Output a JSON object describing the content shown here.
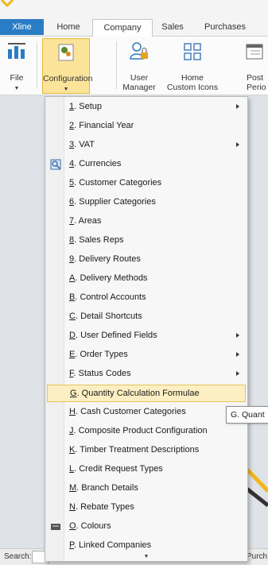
{
  "tabs": [
    {
      "label": "Xline"
    },
    {
      "label": "Home"
    },
    {
      "label": "Company"
    },
    {
      "label": "Sales"
    },
    {
      "label": "Purchases"
    }
  ],
  "ribbon": {
    "file": {
      "label": "File"
    },
    "configuration": {
      "label": "Configuration"
    },
    "user_manager": {
      "label_line1": "User",
      "label_line2": "Manager"
    },
    "home_custom_icons": {
      "label_line1": "Home",
      "label_line2": "Custom Icons"
    },
    "post_period": {
      "label_line1": "Post",
      "label_line2": "Perio"
    }
  },
  "menu": {
    "items": [
      {
        "key": "1",
        "rest": ". Setup",
        "submenu": true,
        "icon": ""
      },
      {
        "key": "2",
        "rest": ". Financial Year",
        "submenu": false,
        "icon": ""
      },
      {
        "key": "3",
        "rest": ". VAT",
        "submenu": true,
        "icon": ""
      },
      {
        "key": "4",
        "rest": ". Currencies",
        "submenu": false,
        "icon": "currency-search-icon"
      },
      {
        "key": "5",
        "rest": ". Customer Categories",
        "submenu": false,
        "icon": ""
      },
      {
        "key": "6",
        "rest": ". Supplier Categories",
        "submenu": false,
        "icon": ""
      },
      {
        "key": "7",
        "rest": ". Areas",
        "submenu": false,
        "icon": ""
      },
      {
        "key": "8",
        "rest": ". Sales Reps",
        "submenu": false,
        "icon": ""
      },
      {
        "key": "9",
        "rest": ". Delivery Routes",
        "submenu": false,
        "icon": ""
      },
      {
        "key": "A",
        "rest": ". Delivery Methods",
        "submenu": false,
        "icon": ""
      },
      {
        "key": "B",
        "rest": ". Control Accounts",
        "submenu": false,
        "icon": ""
      },
      {
        "key": "C",
        "rest": ". Detail Shortcuts",
        "submenu": false,
        "icon": ""
      },
      {
        "key": "D",
        "rest": ". User Defined Fields",
        "submenu": true,
        "icon": ""
      },
      {
        "key": "E",
        "rest": ". Order Types",
        "submenu": true,
        "icon": ""
      },
      {
        "key": "F",
        "rest": ". Status Codes",
        "submenu": true,
        "icon": ""
      },
      {
        "key": "G",
        "rest": ". Quantity Calculation Formulae",
        "submenu": false,
        "icon": "",
        "highlighted": true
      },
      {
        "key": "H",
        "rest": ". Cash Customer Categories",
        "submenu": false,
        "icon": ""
      },
      {
        "key": "J",
        "rest": ". Composite Product Configuration",
        "submenu": false,
        "icon": ""
      },
      {
        "key": "K",
        "rest": ". Timber Treatment Descriptions",
        "submenu": false,
        "icon": ""
      },
      {
        "key": "L",
        "rest": ". Credit Request Types",
        "submenu": false,
        "icon": ""
      },
      {
        "key": "M",
        "rest": ". Branch Details",
        "submenu": false,
        "icon": ""
      },
      {
        "key": "N",
        "rest": ". Rebate Types",
        "submenu": false,
        "icon": ""
      },
      {
        "key": "O",
        "rest": ". Colours",
        "submenu": false,
        "icon": "colours-icon"
      },
      {
        "key": "P",
        "rest": ". Linked Companies",
        "submenu": false,
        "icon": ""
      }
    ]
  },
  "tooltip": {
    "text": "G. Quant"
  },
  "bottom": {
    "search_label": "Search:",
    "right_text": "Purch"
  },
  "colors": {
    "accent": "#2a7cc4",
    "highlight": "#fcefc3",
    "highlight_border": "#e8c35a",
    "config_button": "#fbe49a"
  }
}
